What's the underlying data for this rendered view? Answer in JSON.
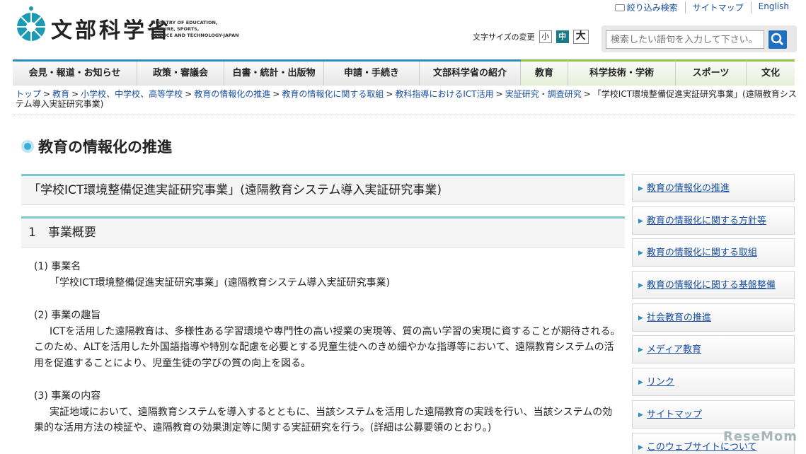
{
  "header": {
    "logo_jp": "文部科学省",
    "logo_en": [
      "MINISTRY OF EDUCATION,",
      "CULTURE, SPORTS,",
      "SCIENCE AND TECHNOLOGY-JAPAN"
    ],
    "toplinks": [
      "絞り込み検索",
      "サイトマップ",
      "English"
    ],
    "fontsize_label": "文字サイズの変更",
    "fontsize": [
      "小",
      "中",
      "大"
    ],
    "search_placeholder": "検索したい語句を入力して下さい。"
  },
  "nav": [
    "会見・報道・お知らせ",
    "政策・審議会",
    "白書・統計・出版物",
    "申請・手続き",
    "文部科学省の紹介",
    "教育",
    "科学技術・学術",
    "スポーツ",
    "文化"
  ],
  "breadcrumb": [
    "トップ",
    "教育",
    "小学校、中学校、高等学校",
    "教育の情報化の推進",
    "教育の情報化に関する取組",
    "教科指導におけるICT活用",
    "実証研究・調査研究",
    "「学校ICT環境整備促進実証研究事業」(遠隔教育システム導入実証研究事業)"
  ],
  "section_title": "教育の情報化の推進",
  "main": {
    "h2": "「学校ICT環境整備促進実証研究事業」(遠隔教育システム導入実証研究事業)",
    "h3": "1　事業概要",
    "items": [
      {
        "head": "(1) 事業名",
        "text": "「学校ICT環境整備促進実証研究事業」(遠隔教育システム導入実証研究事業)"
      },
      {
        "head": "(2) 事業の趣旨",
        "text": "ICTを活用した遠隔教育は、多様性ある学習環境や専門性の高い授業の実現等、質の高い学習の実現に資することが期待される。このため、ALTを活用した外国語指導や特別な配慮を必要とする児童生徒へのきめ細やかな指導等において、遠隔教育システムの活用を促進することにより、児童生徒の学びの質の向上を図る。"
      },
      {
        "head": "(3) 事業の内容",
        "text": "実証地域において、遠隔教育システムを導入するとともに、当該システムを活用した遠隔教育の実践を行い、当該システムの効果的な活用方法の検証や、遠隔教育の効果測定等に関する実証研究を行う。(詳細は公募要領のとおり。)"
      }
    ]
  },
  "side": [
    "教育の情報化の推進",
    "教育の情報化に関する方針等",
    "教育の情報化に関する取組",
    "教育の情報化に関する基盤整備",
    "社会教育の推進",
    "メディア教育",
    "リンク",
    "サイトマップ",
    "このウェブサイトについて"
  ],
  "watermark": "ReseMom"
}
